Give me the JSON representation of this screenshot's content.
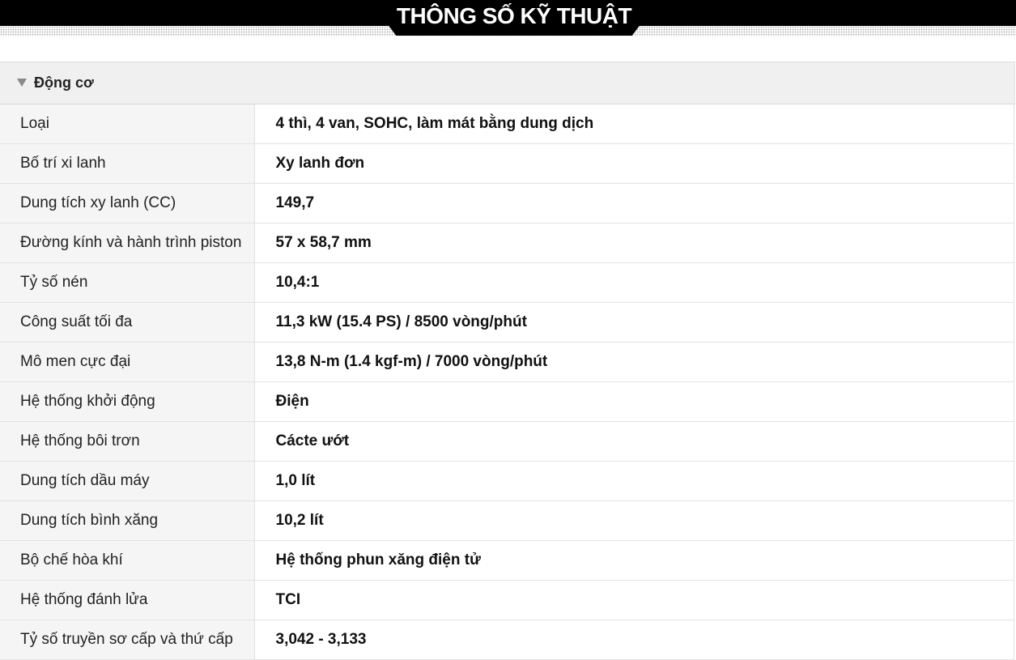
{
  "banner": {
    "title": "THÔNG SỐ KỸ THUẬT"
  },
  "section": {
    "title": "Động cơ",
    "icon": "triangle-down-icon"
  },
  "specs": [
    {
      "label": "Loại",
      "value": "4 thì, 4 van, SOHC, làm mát bằng dung dịch"
    },
    {
      "label": "Bố trí xi lanh",
      "value": "Xy lanh đơn"
    },
    {
      "label": "Dung tích xy lanh (CC)",
      "value": "149,7"
    },
    {
      "label": "Đường kính và hành trình piston",
      "value": "57 x 58,7 mm"
    },
    {
      "label": "Tỷ số nén",
      "value": "10,4:1"
    },
    {
      "label": "Công suất tối đa",
      "value": "11,3 kW (15.4 PS) / 8500 vòng/phút"
    },
    {
      "label": "Mô men cực đại",
      "value": "13,8 N-m (1.4 kgf-m) / 7000 vòng/phút"
    },
    {
      "label": "Hệ thống khởi động",
      "value": "Điện"
    },
    {
      "label": "Hệ thống bôi trơn",
      "value": "Cácte ướt"
    },
    {
      "label": "Dung tích dầu máy",
      "value": "1,0 lít"
    },
    {
      "label": "Dung tích bình xăng",
      "value": "10,2 lít"
    },
    {
      "label": "Bộ chế hòa khí",
      "value": "Hệ thống phun xăng điện tử"
    },
    {
      "label": "Hệ thống đánh lửa",
      "value": "TCI"
    },
    {
      "label": "Tỷ số truyền sơ cấp và thứ cấp",
      "value": "3,042 - 3,133"
    }
  ]
}
